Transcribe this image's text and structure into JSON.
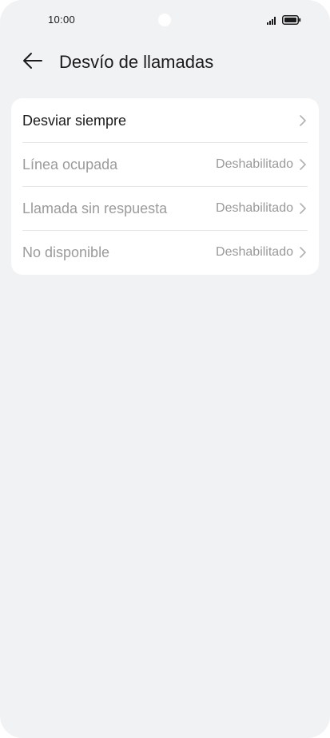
{
  "status_bar": {
    "time": "10:00",
    "icons": [
      "signal-icon",
      "battery-icon"
    ]
  },
  "header": {
    "back_icon": "arrow-left-icon",
    "title": "Desvío de llamadas"
  },
  "options": [
    {
      "label": "Desviar siempre",
      "value": "",
      "enabled": true
    },
    {
      "label": "Línea ocupada",
      "value": "Deshabilitado",
      "enabled": false
    },
    {
      "label": "Llamada sin respuesta",
      "value": "Deshabilitado",
      "enabled": false
    },
    {
      "label": "No disponible",
      "value": "Deshabilitado",
      "enabled": false
    }
  ],
  "colors": {
    "background": "#f1f2f4",
    "card": "#ffffff",
    "text_primary": "#1b1b1b",
    "text_disabled": "#9b9b9b",
    "chevron": "#b0b0b0"
  }
}
